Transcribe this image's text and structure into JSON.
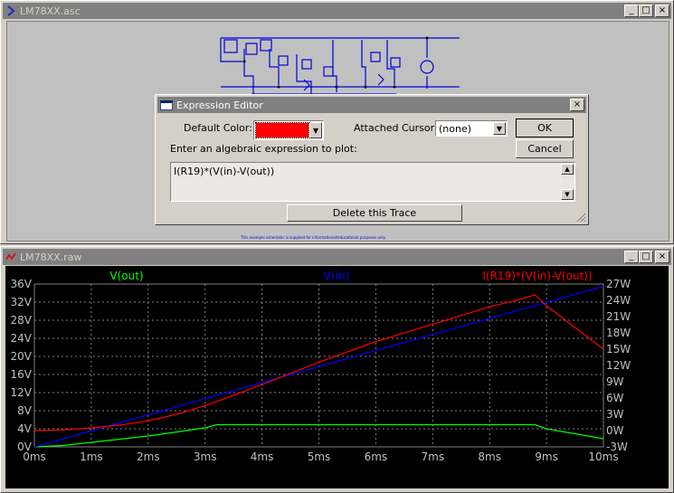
{
  "schematic_window": {
    "title": "LM78XX.asc",
    "title_icon": "ltspice-schematic-icon",
    "buttons": {
      "minimize": "_",
      "maximize": "□",
      "close": "×"
    },
    "note_text": "This example schematic is supplied for informational/educational purposes only."
  },
  "dialog": {
    "title": "Expression Editor",
    "default_color_label": "Default Color:",
    "default_color_value": "#ff0000",
    "attached_cursor_label": "Attached Cursor:",
    "attached_cursor_value": "(none)",
    "ok_label": "OK",
    "cancel_label": "Cancel",
    "prompt_label": "Enter an algebraic expression to plot:",
    "expression": "I(R19)*(V(in)-V(out))",
    "delete_label": "Delete this Trace",
    "close_glyph": "×"
  },
  "waveform_window": {
    "title": "LM78XX.raw",
    "title_icon": "waveform-icon",
    "buttons": {
      "minimize": "_",
      "maximize": "□",
      "close": "×"
    }
  },
  "chart_data": {
    "type": "line",
    "x_label_ticks": [
      "0ms",
      "1ms",
      "2ms",
      "3ms",
      "4ms",
      "5ms",
      "6ms",
      "7ms",
      "8ms",
      "9ms",
      "10ms"
    ],
    "x_range_ms": [
      0,
      10
    ],
    "left_axis": {
      "unit": "V",
      "range": [
        0,
        36
      ],
      "ticks": [
        "36V",
        "32V",
        "28V",
        "24V",
        "20V",
        "16V",
        "12V",
        "8V",
        "4V",
        "0V"
      ]
    },
    "right_axis": {
      "unit": "W",
      "range": [
        -3,
        27
      ],
      "ticks": [
        "27W",
        "24W",
        "21W",
        "18W",
        "15W",
        "12W",
        "9W",
        "6W",
        "3W",
        "0W",
        "-3W"
      ]
    },
    "grid": true,
    "series": [
      {
        "name": "V(out)",
        "axis": "left",
        "color": "#00ff00",
        "x": [
          0,
          0.5,
          1,
          1.5,
          2,
          2.5,
          3,
          3.2,
          4,
          5,
          6,
          7,
          8,
          8.8,
          9,
          10
        ],
        "y": [
          0,
          0.3,
          1.0,
          1.7,
          2.4,
          3.3,
          4.2,
          4.9,
          4.9,
          4.9,
          4.9,
          4.9,
          4.9,
          4.9,
          4.0,
          1.8
        ]
      },
      {
        "name": "V(in)",
        "axis": "left",
        "color": "#0000ff",
        "x": [
          0,
          10
        ],
        "y": [
          0,
          35.5
        ]
      },
      {
        "name": "I(R19)*(V(in)-V(out))",
        "axis": "right",
        "color": "#ff0000",
        "x": [
          0,
          0.5,
          1,
          1.5,
          2,
          2.5,
          3,
          3.5,
          4,
          5,
          6,
          7,
          8,
          8.5,
          8.8,
          9,
          9.5,
          10
        ],
        "y": [
          0,
          0.1,
          0.5,
          1.0,
          1.8,
          3.0,
          4.6,
          6.5,
          8.5,
          12.6,
          16.4,
          19.6,
          22.8,
          24.1,
          25.0,
          23.0,
          19.0,
          15.0
        ]
      }
    ]
  }
}
